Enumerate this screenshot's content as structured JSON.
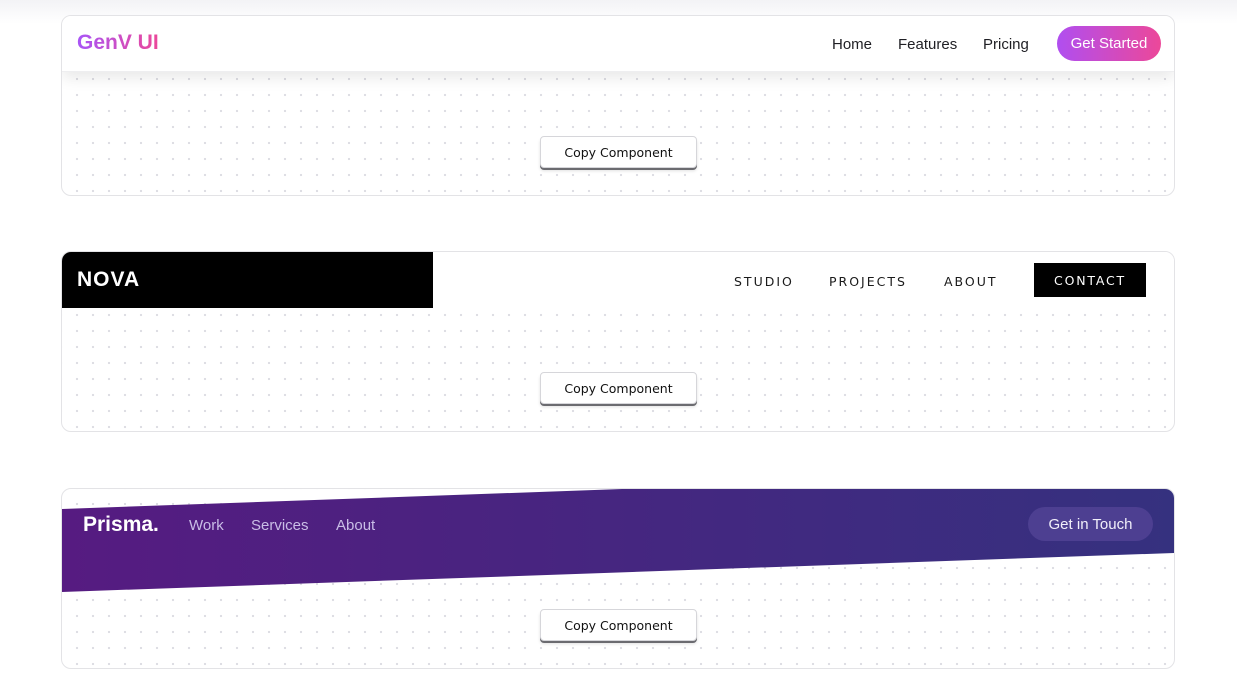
{
  "copy_button_label": "Copy Component",
  "genv": {
    "logo": "GenV UI",
    "links": [
      "Home",
      "Features",
      "Pricing"
    ],
    "cta": "Get Started"
  },
  "nova": {
    "logo": "NOVA",
    "links": [
      "STUDIO",
      "PROJECTS",
      "ABOUT"
    ],
    "cta": "CONTACT"
  },
  "prisma": {
    "logo": "Prisma.",
    "links": [
      "Work",
      "Services",
      "About"
    ],
    "cta": "Get in Touch"
  },
  "colors": {
    "genv_gradient": [
      "#a855f7",
      "#ec4899"
    ],
    "nova_black": "#000000",
    "prisma_gradient": [
      "#561b81",
      "#35317f"
    ],
    "prisma_cta_bg": "#4d3f91"
  }
}
